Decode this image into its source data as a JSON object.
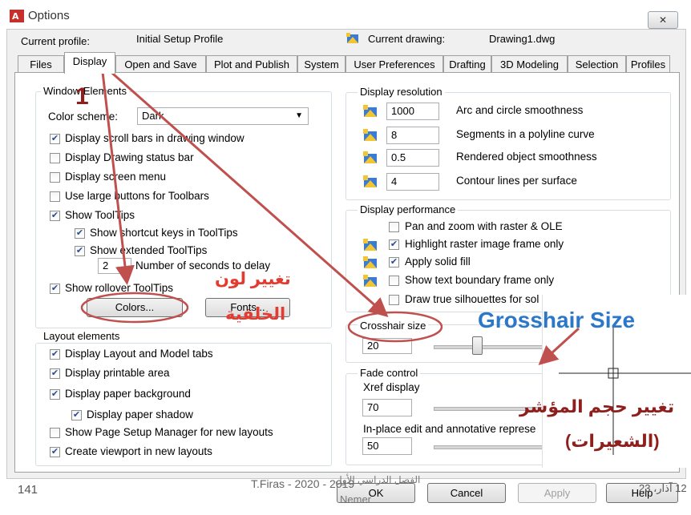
{
  "window": {
    "title": "Options",
    "app_badge": "A",
    "close_glyph": "✕"
  },
  "profile": {
    "label": "Current profile:",
    "value": "Initial Setup Profile"
  },
  "drawing": {
    "label": "Current drawing:",
    "value": "Drawing1.dwg"
  },
  "tabs": [
    "Files",
    "Display",
    "Open and Save",
    "Plot and Publish",
    "System",
    "User Preferences",
    "Drafting",
    "3D Modeling",
    "Selection",
    "Profiles"
  ],
  "active_tab": "Display",
  "window_elements": {
    "title": "Window Elements",
    "color_scheme_label": "Color scheme:",
    "color_scheme_value": "Dark",
    "checks": [
      {
        "label": "Display scroll bars in drawing window",
        "checked": true
      },
      {
        "label": "Display Drawing status bar",
        "checked": false
      },
      {
        "label": "Display screen menu",
        "checked": false
      },
      {
        "label": "Use large buttons for Toolbars",
        "checked": false
      },
      {
        "label": "Show ToolTips",
        "checked": true
      },
      {
        "label": "Show shortcut keys in ToolTips",
        "checked": true
      },
      {
        "label": "Show extended ToolTips",
        "checked": true
      }
    ],
    "delay_value": "2",
    "delay_label": "Number of seconds to delay",
    "rollover_label": "Show rollover ToolTips",
    "rollover_checked": true,
    "colors_button": "Colors...",
    "fonts_button": "Fonts..."
  },
  "layout_elements": {
    "title": "Layout elements",
    "checks": [
      {
        "label": "Display Layout and Model tabs",
        "checked": true
      },
      {
        "label": "Display printable area",
        "checked": true
      },
      {
        "label": "Display paper background",
        "checked": true
      },
      {
        "label": "Display paper shadow",
        "checked": true
      },
      {
        "label": "Show Page Setup Manager for new layouts",
        "checked": false
      },
      {
        "label": "Create viewport in new layouts",
        "checked": true
      }
    ]
  },
  "display_resolution": {
    "title": "Display resolution",
    "rows": [
      {
        "value": "1000",
        "label": "Arc and circle smoothness"
      },
      {
        "value": "8",
        "label": "Segments in a polyline curve"
      },
      {
        "value": "0.5",
        "label": "Rendered object smoothness"
      },
      {
        "value": "4",
        "label": "Contour lines per surface"
      }
    ]
  },
  "display_performance": {
    "title": "Display performance",
    "rows": [
      {
        "label": "Pan and zoom with raster & OLE",
        "checked": false,
        "icon": false
      },
      {
        "label": "Highlight raster image frame only",
        "checked": true,
        "icon": true
      },
      {
        "label": "Apply solid fill",
        "checked": true,
        "icon": true
      },
      {
        "label": "Show text boundary frame only",
        "checked": false,
        "icon": true
      },
      {
        "label": "Draw true silhouettes for sol",
        "checked": false,
        "icon": false
      }
    ]
  },
  "crosshair": {
    "title": "Crosshair size",
    "value": "20",
    "slider_fraction": 0.2
  },
  "fade_control": {
    "title": "Fade control",
    "xref_label": "Xref display",
    "xref_value": "70",
    "inplace_label": "In-place edit and annotative represe",
    "inplace_value": "50"
  },
  "buttons": {
    "ok": "OK",
    "cancel": "Cancel",
    "apply": "Apply",
    "help": "Help"
  },
  "annotations": {
    "step_number": "1",
    "colors_note_line1": "تغيير لون",
    "colors_note_line2": "الخلفية",
    "crosshair_heading": "Grosshair Size",
    "crosshair_note_line1": "تغيير حجم المؤشر",
    "crosshair_note_line2": "(الشعيرات)",
    "red_color": "#e43b30",
    "blue_color": "#2b77c9",
    "maroon_color": "#8e1f1c"
  },
  "footer": {
    "page_number": "141",
    "author_year": "T.Firas - 2020 - 2019",
    "semester": "الفصل الدراسي الأول",
    "author_ar": "Nemer",
    "date": "12 آذار، 23"
  }
}
